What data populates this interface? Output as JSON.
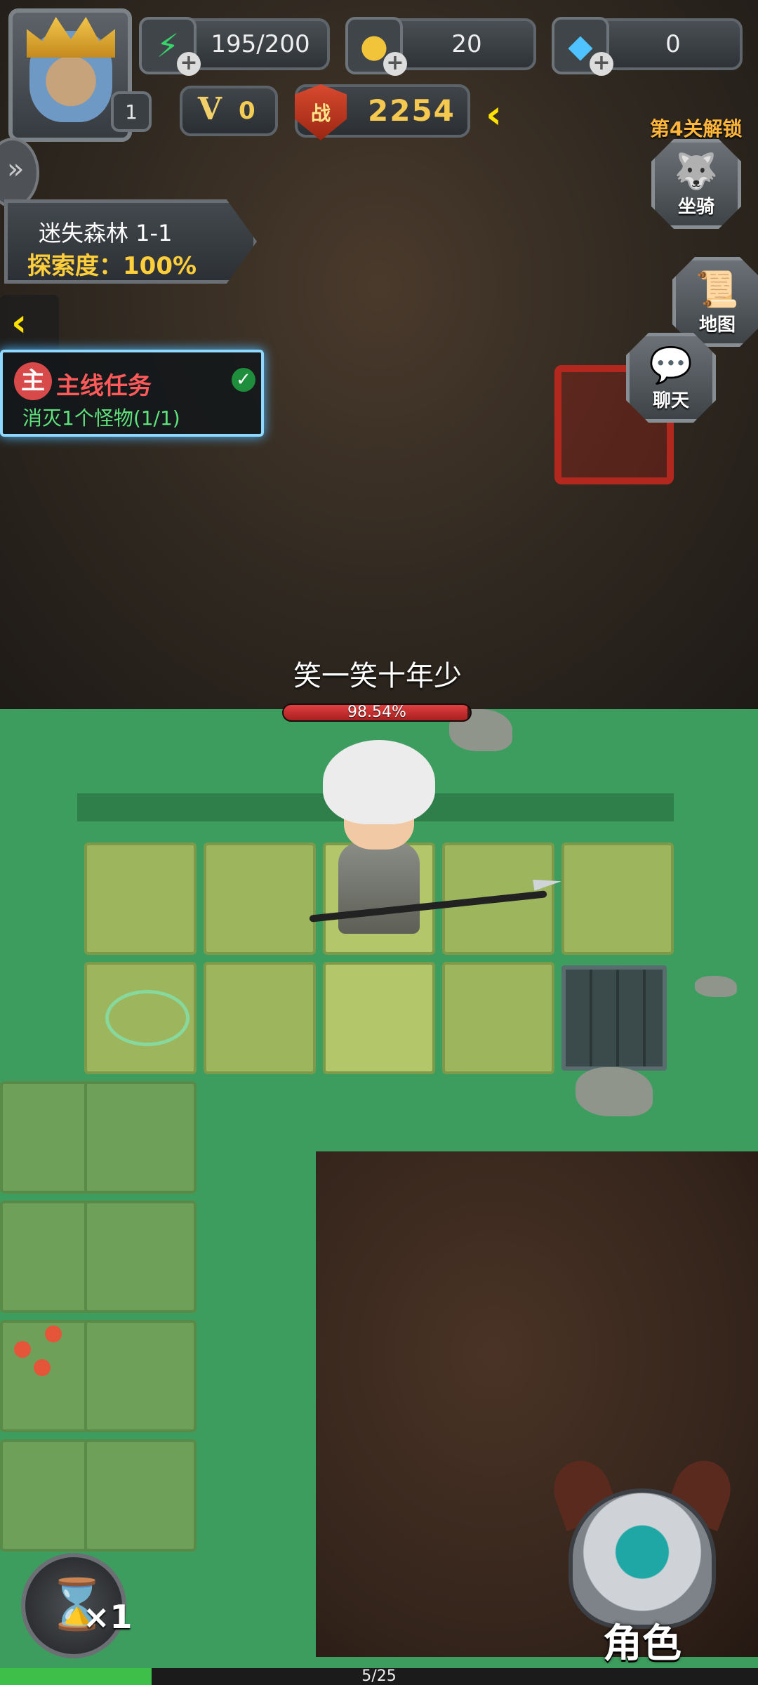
{
  "player": {
    "level": "1"
  },
  "resources": {
    "energy": {
      "value": "195/200",
      "icon": "lightning-icon",
      "color": "#37d36b"
    },
    "gold": {
      "value": "20",
      "icon": "gold-coin-icon",
      "color": "#f2c43a"
    },
    "diamond": {
      "value": "0",
      "icon": "diamond-icon",
      "color": "#4fc3ff"
    }
  },
  "vip": {
    "label": "V",
    "value": "0"
  },
  "combat_power": {
    "badge": "战",
    "value": "2254"
  },
  "side_menu": {
    "mount": {
      "label": "坐骑",
      "unlock_note": "第4关解锁"
    },
    "map": {
      "label": "地图"
    },
    "chat": {
      "label": "聊天"
    }
  },
  "stage": {
    "name": "迷失森林 1-1",
    "exploration": "探索度：100%"
  },
  "quest": {
    "tag": "主",
    "title": "主线任务",
    "desc": "消灭1个怪物(1/1)",
    "completed": true
  },
  "character": {
    "name": "笑一笑十年少",
    "hp_text": "98.54%",
    "hp_fraction": 0.9854
  },
  "speed": {
    "multiplier": "×1"
  },
  "role_button": {
    "label": "角色"
  },
  "map_progress": {
    "text": "5/25",
    "fraction": 0.2
  }
}
